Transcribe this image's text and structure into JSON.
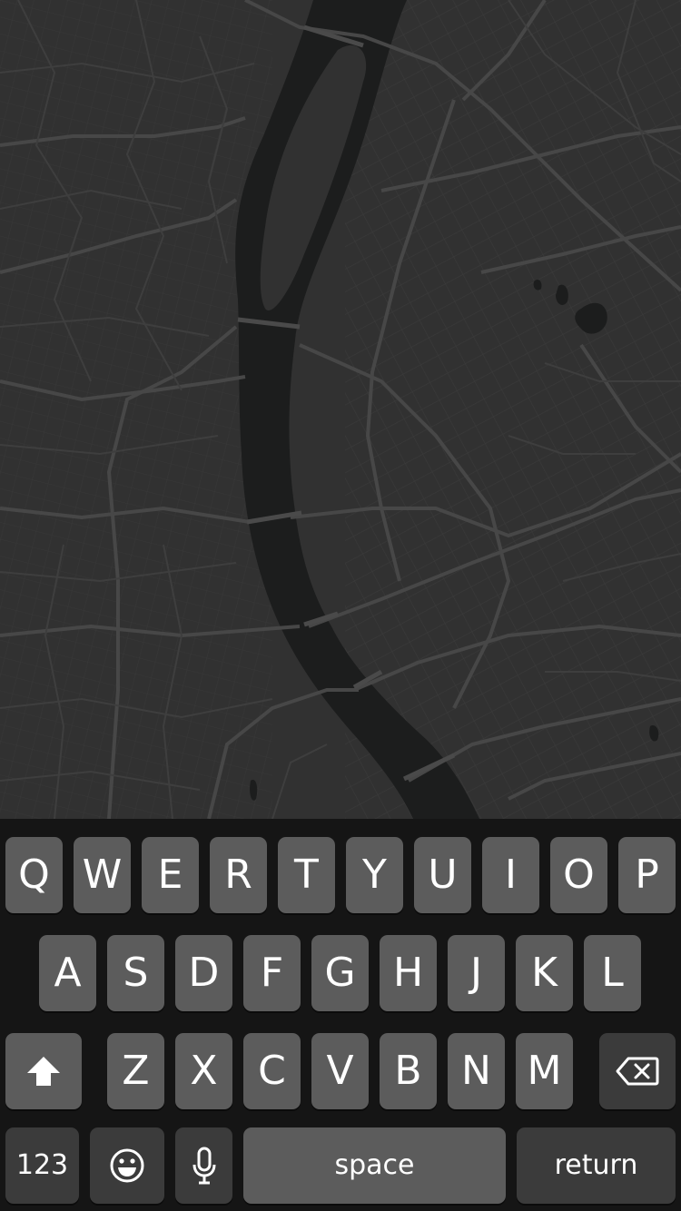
{
  "map": {
    "theme": "dark",
    "land_color": "#313131",
    "water_color": "#1c1d1d",
    "road_color": "#454545"
  },
  "keyboard": {
    "row1": [
      "Q",
      "W",
      "E",
      "R",
      "T",
      "Y",
      "U",
      "I",
      "O",
      "P"
    ],
    "row2": [
      "A",
      "S",
      "D",
      "F",
      "G",
      "H",
      "J",
      "K",
      "L"
    ],
    "row3": [
      "Z",
      "X",
      "C",
      "V",
      "B",
      "N",
      "M"
    ],
    "shift_icon": "shift-arrow-icon",
    "delete_icon": "backspace-icon",
    "numbers_label": "123",
    "emoji_icon": "emoji-smiley-icon",
    "mic_icon": "microphone-icon",
    "space_label": "space",
    "return_label": "return",
    "key_color": "#5c5c5c",
    "function_key_color": "#3b3b3b",
    "background_color": "#151515"
  }
}
